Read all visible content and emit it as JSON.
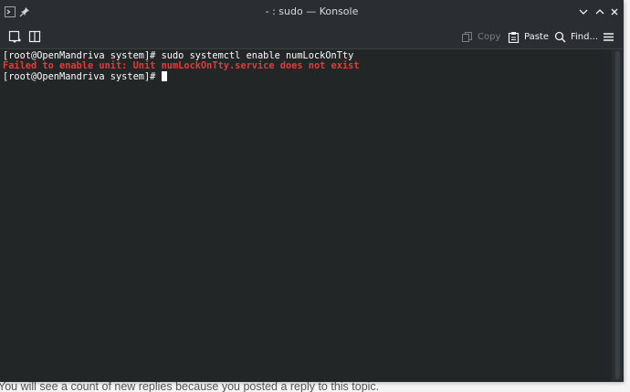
{
  "window": {
    "title": "- : sudo — Konsole"
  },
  "toolbar": {
    "copy_label": "Copy",
    "paste_label": "Paste",
    "find_label": "Find..."
  },
  "terminal": {
    "lines": [
      {
        "text": "[root@OpenMandriva system]# sudo systemctl enable numLockOnTty",
        "type": "normal"
      },
      {
        "text": "Failed to enable unit: Unit numLockOnTty.service does not exist",
        "type": "error"
      },
      {
        "text": "[root@OpenMandriva system]# ",
        "type": "prompt"
      }
    ]
  },
  "background": {
    "notice": "You will see a count of new replies because you posted a reply to this topic."
  },
  "colors": {
    "terminal_bg": "#232627",
    "titlebar_bg": "#2a2e32",
    "error_text": "#e53a3a",
    "normal_text": "#fcfcfc"
  }
}
